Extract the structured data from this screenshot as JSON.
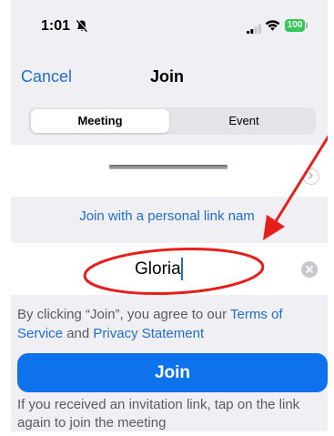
{
  "status_bar": {
    "time": "1:01",
    "battery": "100",
    "battery_color": "#34c759"
  },
  "nav": {
    "cancel_label": "Cancel",
    "title": "Join"
  },
  "segmented_control": {
    "options": [
      "Meeting",
      "Event"
    ],
    "selected": "Meeting"
  },
  "join_form": {
    "personal_link_label": "Join with a personal link nam",
    "name_value": "Gloria"
  },
  "terms": {
    "prefix": "By clicking “Join”, you agree to our ",
    "terms_link": "Terms of Service",
    "middle": " and ",
    "privacy_link": "Privacy Statement"
  },
  "join_button_label": "Join",
  "invite_note": "If you received an invitation link, tap on the link again to join the meeting",
  "colors": {
    "accent": "#1f6ed4",
    "primary_button": "#0e72ed",
    "annotation": "#e5201b"
  },
  "icons": [
    "bell-slash-icon",
    "signal-icon",
    "wifi-icon",
    "battery-icon",
    "chevron-right-icon",
    "clear-icon"
  ]
}
